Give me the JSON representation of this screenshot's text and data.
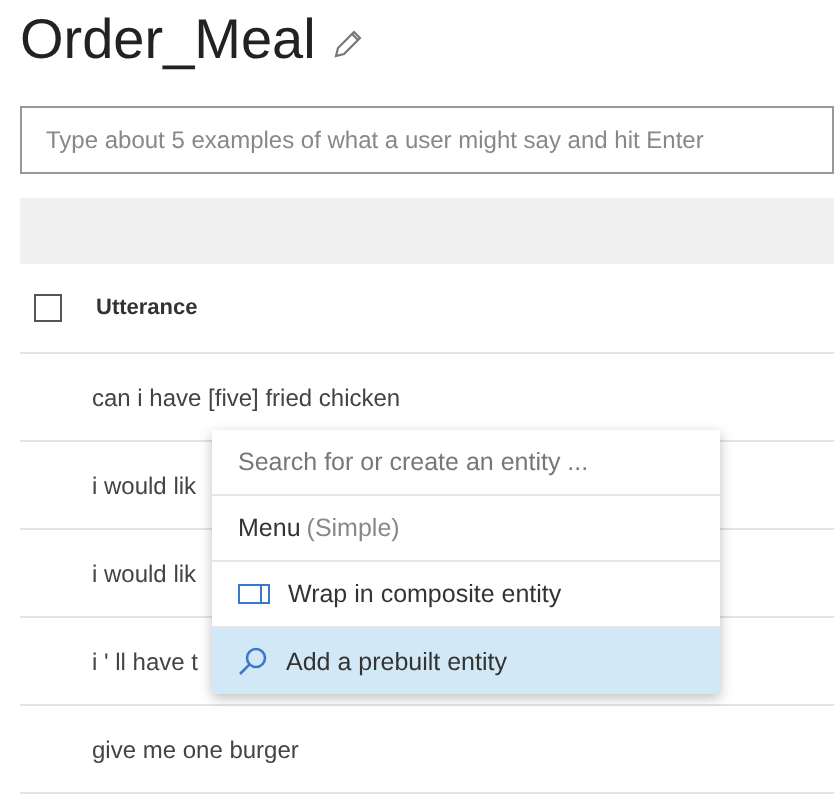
{
  "page": {
    "title": "Order_Meal"
  },
  "utterance_input": {
    "placeholder": "Type about 5 examples of what a user might say and hit Enter"
  },
  "table": {
    "select_all": {
      "checked": false
    },
    "columns": [
      "Utterance"
    ],
    "rows": [
      {
        "text": "can i have [five] fried chicken"
      },
      {
        "text": "i would lik"
      },
      {
        "text": "i would lik"
      },
      {
        "text": "i ' ll have t"
      },
      {
        "text": "give me one burger"
      }
    ]
  },
  "entity_menu": {
    "search_placeholder": "Search for or create an entity ...",
    "items": [
      {
        "kind": "entity",
        "name": "Menu",
        "type": "(Simple)",
        "selected": false
      },
      {
        "kind": "composite",
        "label": "Wrap in composite entity",
        "selected": false
      },
      {
        "kind": "prebuilt",
        "label": "Add a prebuilt entity",
        "selected": true
      }
    ]
  }
}
